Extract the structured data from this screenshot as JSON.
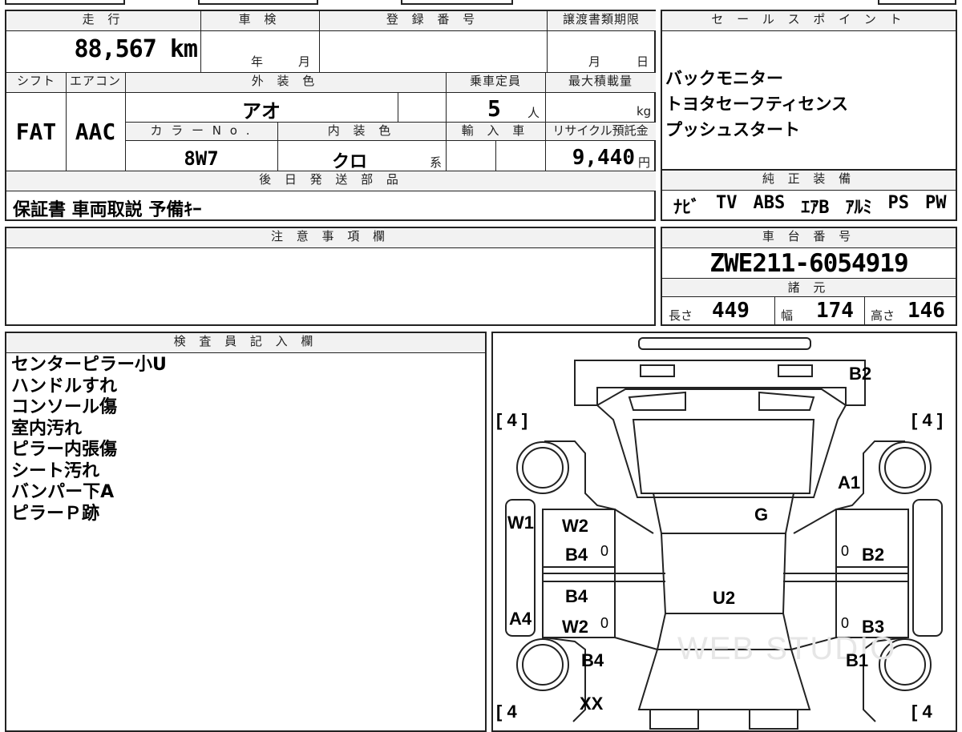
{
  "top": {
    "mileage_header": "走 行",
    "mileage_value": "88,567 km",
    "inspection_header": "車 検",
    "inspection_year": "年",
    "inspection_month": "月",
    "registration_header": "登 録 番 号",
    "transfer_header": "譲渡書類期限",
    "transfer_month": "月",
    "transfer_day": "日",
    "shift_header": "シフト",
    "shift_value": "FAT",
    "ac_header": "エアコン",
    "ac_value": "AAC",
    "exterior_header": "外 装 色",
    "exterior_value": "アオ",
    "capacity_header": "乗車定員",
    "capacity_value": "5",
    "capacity_unit": "人",
    "maxload_header": "最大積載量",
    "maxload_unit": "kg",
    "color_no_header": "カ ラ ー N o .",
    "color_no_value": "8W7",
    "interior_header": "内 装 色",
    "interior_value": "クロ",
    "interior_suffix": "系",
    "import_header": "輸 入 車",
    "recycle_header": "リサイクル預託金",
    "recycle_value": "9,440",
    "recycle_unit": "円",
    "later_parts_header": "後 日 発 送 部 品",
    "later_parts_value": "保証書 車両取説 予備ｷｰ"
  },
  "sales": {
    "header": "セ ー ル ス ポ イ ン ト",
    "points": [
      "バックモニター",
      "トヨタセーフティセンス",
      "プッシュスタート"
    ]
  },
  "equipment": {
    "header": "純 正 装 備",
    "items": [
      "ﾅﾋﾞ",
      "TV",
      "ABS",
      "ｴｱB",
      "ｱﾙﾐ",
      "PS",
      "PW"
    ]
  },
  "notes": {
    "header": "注 意 事 項 欄"
  },
  "chassis": {
    "header": "車 台 番 号",
    "value": "ZWE211-6054919",
    "specs_header": "諸 元",
    "length_label": "長さ",
    "length_value": "449",
    "width_label": "幅",
    "width_value": "174",
    "height_label": "高さ",
    "height_value": "146"
  },
  "inspector": {
    "header": "検 査 員 記 入 欄",
    "lines": [
      "センターピラー小U",
      "ハンドルすれ",
      "コンソール傷",
      "室内汚れ",
      "ピラー内張傷",
      "シート汚れ",
      "バンパー下A",
      "ピラーＰ跡"
    ]
  },
  "diagram": {
    "watermark": "WEB STUDIO",
    "marks": {
      "front_bumper": "B2",
      "hood": "A1",
      "windshield": "G",
      "roof": "U2",
      "left_fender": "W1",
      "left_front_door_1": "W2",
      "left_front_door_2": "B4",
      "left_rear_door_1": "B4",
      "left_rear_door_2": "W2",
      "left_rear_qtr": "A4",
      "right_front_door": "B2",
      "right_rear_door": "B3",
      "left_rear_fender": "B4",
      "right_rear_fender": "B1",
      "rear": "XX",
      "tire_fl": "[ 4 ]",
      "tire_fr": "[ 4 ]",
      "tire_rl": "[ 4",
      "tire_rr": "[ 4",
      "zero": "0"
    }
  }
}
